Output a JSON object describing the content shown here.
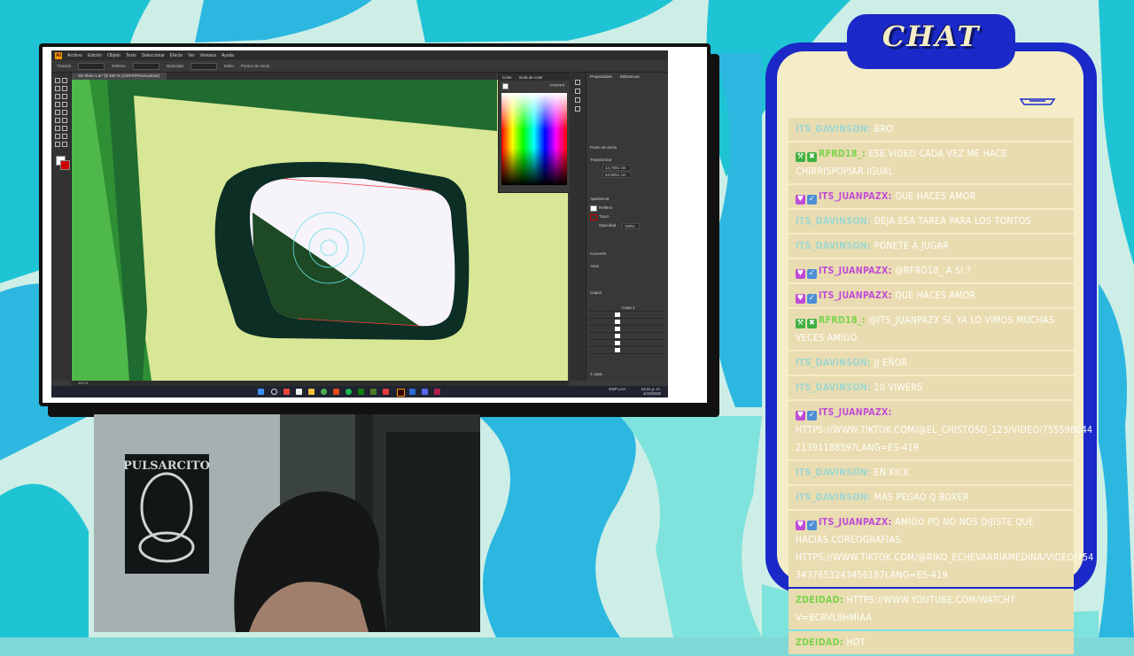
{
  "screen_capture": {
    "app": {
      "logo": "Ai",
      "menu": [
        "Archivo",
        "Edición",
        "Objeto",
        "Texto",
        "Seleccionar",
        "Efecto",
        "Ver",
        "Ventana",
        "Ayuda"
      ],
      "options_bar": [
        "Trazado",
        "Relleno",
        "Opacidad",
        "Estilo",
        "Puntos de ancla"
      ],
      "document_tab": "Sin título-1.ai* @ 400 % (CMYK/Previsualizar)",
      "color_panel": {
        "tabs": [
          "Color",
          "Guía de color"
        ],
        "hex": "FFFFFF"
      },
      "properties_panel": {
        "tabs": [
          "Propiedades",
          "Bibliotecas"
        ],
        "labels": [
          "Punto de ancla",
          "Transformar",
          "Apariencia",
          "Relleno",
          "Trazo",
          "Opacidad",
          "Convertir",
          "Asas",
          "Capas"
        ],
        "values": [
          "14,7081 cm",
          "44,9251 cm",
          "100%"
        ]
      },
      "layers": {
        "title": "Capa 1",
        "count": 7,
        "footer": "1 capa"
      },
      "status": "400 %"
    },
    "taskbar": {
      "lang": "ESP LAA",
      "time": "10:31 p. m.",
      "date": "4/10/2025",
      "icons": [
        "windows-icon",
        "search-icon",
        "task-icon",
        "folder-icon",
        "chrome-icon",
        "browser-icon",
        "spotify-icon",
        "xbox-icon",
        "app-icon",
        "illustrator-icon",
        "mail-icon",
        "other-icon",
        "other-icon-2"
      ]
    }
  },
  "webcam": {
    "poster_text": "PULSARCITO"
  },
  "chat": {
    "title": "CHAT",
    "messages": [
      {
        "user": "ITS_DAVINSON",
        "user_class": "user-d",
        "badges": [],
        "text": "BRO"
      },
      {
        "user": "RFRD18_",
        "user_class": "user-r",
        "badges": [
          "mod",
          "vip"
        ],
        "text": "ESE VIDEO CADA VEZ ME HACE CHIRRISPOPIAR IGUAL"
      },
      {
        "user": "ITS_JUANPAZX",
        "user_class": "user-j",
        "badges": [
          "sub",
          "verified"
        ],
        "text": "QUE HACES AMOR"
      },
      {
        "user": "ITS_DAVINSON",
        "user_class": "user-d",
        "badges": [],
        "text": "DEJA ESA TAREA PARA LOS TONTOS"
      },
      {
        "user": "ITS_DAVINSON",
        "user_class": "user-d",
        "badges": [],
        "text": "PONETE A JUGAR"
      },
      {
        "user": "ITS_JUANPAZX",
        "user_class": "user-j",
        "badges": [
          "sub",
          "verified"
        ],
        "text": "@RFRD18_ A SI ?"
      },
      {
        "user": "ITS_JUANPAZX",
        "user_class": "user-j",
        "badges": [
          "sub",
          "verified"
        ],
        "text": "QUE HACES AMOR"
      },
      {
        "user": "RFRD18_",
        "user_class": "user-r",
        "badges": [
          "mod",
          "vip"
        ],
        "text": "@ITS_JUANPAZX SI, YA LO VIMOS MUCHAS VECES AMIGO"
      },
      {
        "user": "ITS_DAVINSON",
        "user_class": "user-d",
        "badges": [],
        "text": "JJ EÑOR"
      },
      {
        "user": "ITS_DAVINSON",
        "user_class": "user-d",
        "badges": [],
        "text": "10 VIWERS"
      },
      {
        "user": "ITS_JUANPAZX",
        "user_class": "user-j",
        "badges": [
          "sub",
          "verified"
        ],
        "text": "HTTPS://WWW.TIKTOK.COM/@EL_CHISTOSO_123/VIDEO/755598044 2139118859?LANG=ES-419"
      },
      {
        "user": "ITS_DAVINSON",
        "user_class": "user-d",
        "badges": [],
        "text": "EN KICK"
      },
      {
        "user": "ITS_DAVINSON",
        "user_class": "user-d",
        "badges": [],
        "text": "MAS PEGAO Q BOXER"
      },
      {
        "user": "ITS_JUANPAZX",
        "user_class": "user-j",
        "badges": [
          "sub",
          "verified"
        ],
        "text": "AMIGO PQ NO NOS DIJISTE QUE HACIAS COREOGRAFIAS HTTPS://WWW.TIKTOK.COM/@RIKO_ECHEVARRIAMEDINA/VIDEO/754 3437653243456187LANG=ES-419"
      },
      {
        "user": "ZDEIDAD",
        "user_class": "user-z",
        "badges": [],
        "text": "HTTPS://WWW.YOUTUBE.COM/WATCH?V=BCRVL8HMIAA"
      },
      {
        "user": "ZDEIDAD",
        "user_class": "user-z",
        "badges": [],
        "text": "HOT"
      }
    ]
  }
}
